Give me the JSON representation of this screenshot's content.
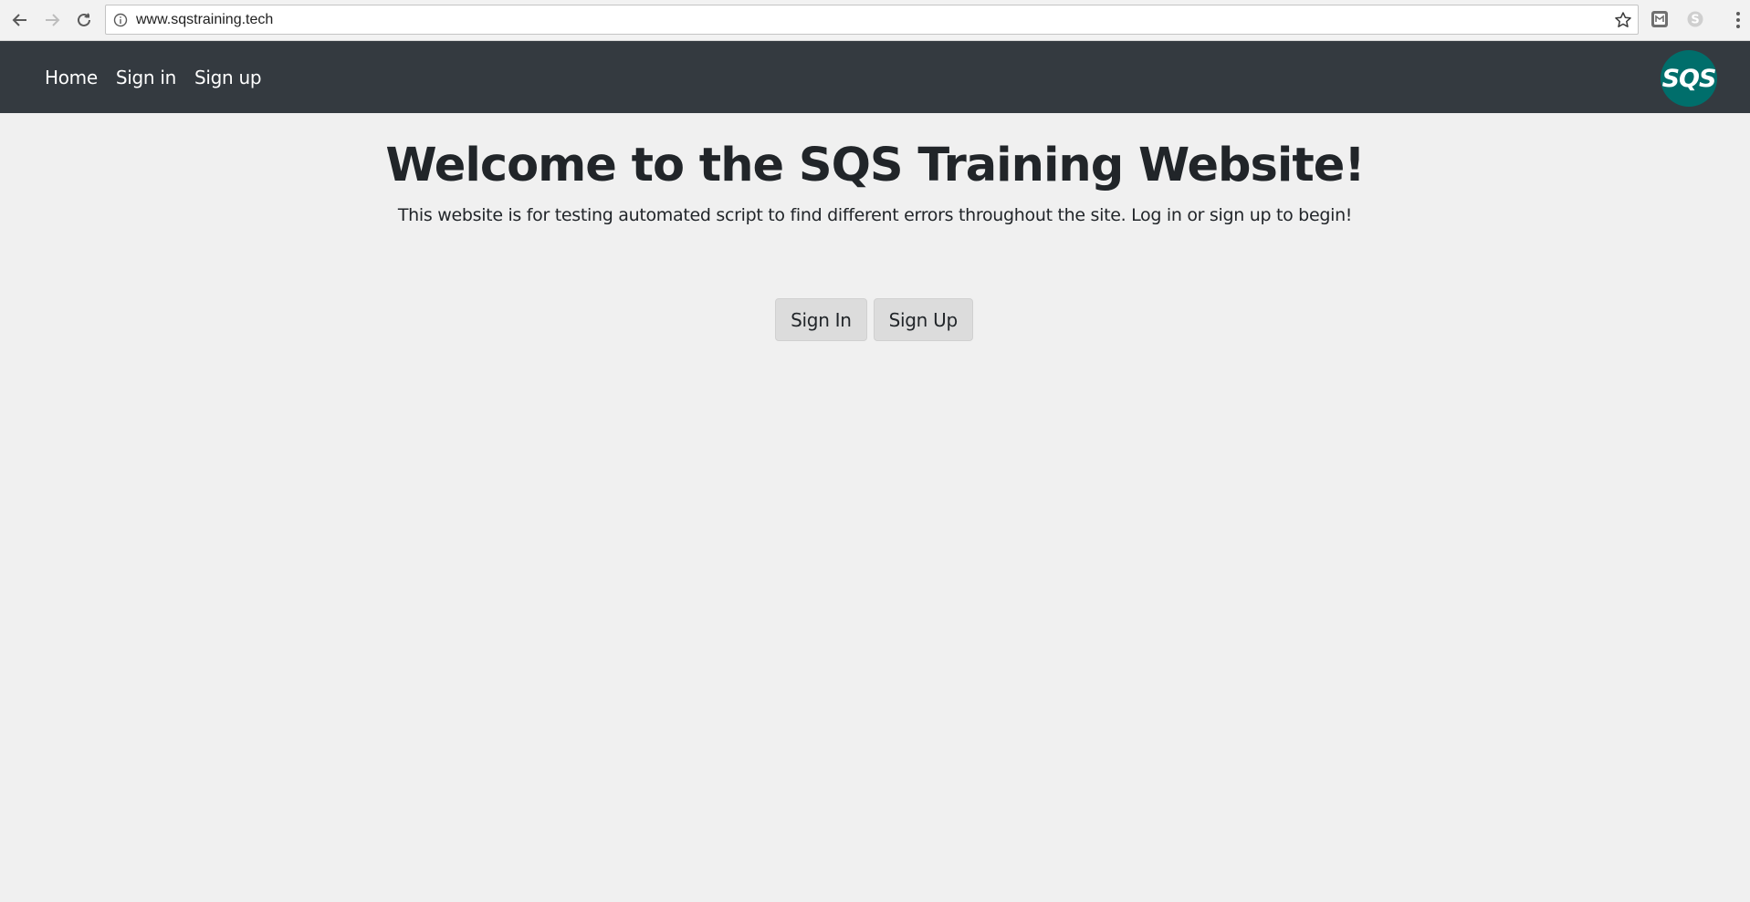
{
  "browser": {
    "url": "www.sqstraining.tech",
    "icons": [
      "back-arrow-icon",
      "forward-arrow-icon",
      "reload-icon",
      "info-icon",
      "star-icon",
      "extension-icon",
      "skype-icon",
      "menu-dots-icon"
    ]
  },
  "navbar": {
    "links": [
      {
        "label": "Home"
      },
      {
        "label": "Sign in"
      },
      {
        "label": "Sign up"
      }
    ],
    "logo_text": "SQS",
    "background": "#343a40",
    "logo_color": "#006e6b"
  },
  "main": {
    "title": "Welcome to the SQS Training Website!",
    "subtitle": "This website is for testing automated script to find different errors throughout the site. Log in or sign up to begin!",
    "buttons": {
      "sign_in": "Sign In",
      "sign_up": "Sign Up"
    }
  }
}
